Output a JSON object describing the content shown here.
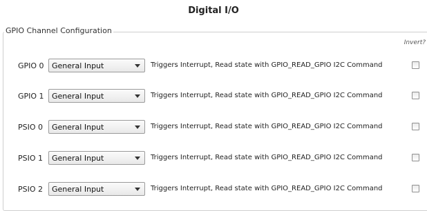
{
  "page_title": "Digital I/O",
  "group_title": "GPIO Channel Configuration",
  "invert_header": "Invert?",
  "channels": [
    {
      "label": "GPIO 0",
      "mode": "General Input",
      "description": "Triggers Interrupt, Read state with GPIO_READ_GPIO I2C Command",
      "invert": false
    },
    {
      "label": "GPIO 1",
      "mode": "General Input",
      "description": "Triggers Interrupt, Read state with GPIO_READ_GPIO I2C Command",
      "invert": false
    },
    {
      "label": "PSIO 0",
      "mode": "General Input",
      "description": "Triggers Interrupt, Read state with GPIO_READ_GPIO I2C Command",
      "invert": false
    },
    {
      "label": "PSIO 1",
      "mode": "General Input",
      "description": "Triggers Interrupt, Read state with GPIO_READ_GPIO I2C Command",
      "invert": false
    },
    {
      "label": "PSIO 2",
      "mode": "General Input",
      "description": "Triggers Interrupt, Read state with GPIO_READ_GPIO I2C Command",
      "invert": false
    }
  ]
}
